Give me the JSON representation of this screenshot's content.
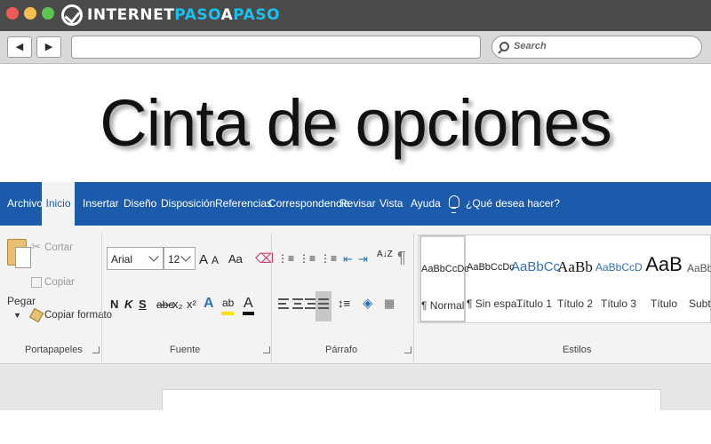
{
  "browser": {
    "logo_part1": "INTERNET",
    "logo_part2": "PASO",
    "logo_part3": "A",
    "logo_part4": "PASO",
    "back_glyph": "◀",
    "forward_glyph": "▶",
    "search_placeholder": "Search"
  },
  "headline": "Cinta de opciones",
  "ribbon": {
    "tabs": [
      "Archivo",
      "Inicio",
      "Insertar",
      "Diseño",
      "Disposición",
      "Referencias",
      "Correspondencia",
      "Revisar",
      "Vista",
      "Ayuda"
    ],
    "active_tab": "Inicio",
    "tell_me": "¿Qué desea hacer?",
    "clipboard": {
      "paste": "Pegar",
      "cut": "Cortar",
      "copy": "Copiar",
      "format_painter": "Copiar formato",
      "group_label": "Portapapeles"
    },
    "font": {
      "font_name": "Arial",
      "font_size": "12",
      "grow": "A",
      "shrink": "A",
      "change_case": "Aa",
      "bold": "N",
      "italic": "K",
      "underline": "S",
      "strikethrough": "abc",
      "subscript": "x₂",
      "superscript": "x²",
      "text_effects": "A",
      "highlight": "ab",
      "font_color": "A",
      "group_label": "Fuente",
      "highlight_color": "#f5e500",
      "font_color_value": "#111111"
    },
    "paragraph": {
      "group_label": "Párrafo",
      "sort": "A↓Z",
      "pilcrow": "¶"
    },
    "styles": {
      "group_label": "Estilos",
      "items": [
        {
          "preview": "AaBbCcDc",
          "name": "¶ Normal"
        },
        {
          "preview": "AaBbCcDc",
          "name": "¶ Sin espa..."
        },
        {
          "preview": "AaBbCc",
          "name": "Título 1"
        },
        {
          "preview": "AaBb",
          "name": "Título 2"
        },
        {
          "preview": "AaBbCcD",
          "name": "Título 3"
        },
        {
          "preview": "AaB",
          "name": "Título"
        },
        {
          "preview": "AaBbCc",
          "name": "Subtítulo"
        }
      ]
    },
    "colors": {
      "tab_bar": "#1c5bab",
      "heading_blue": "#2e74b5"
    }
  }
}
